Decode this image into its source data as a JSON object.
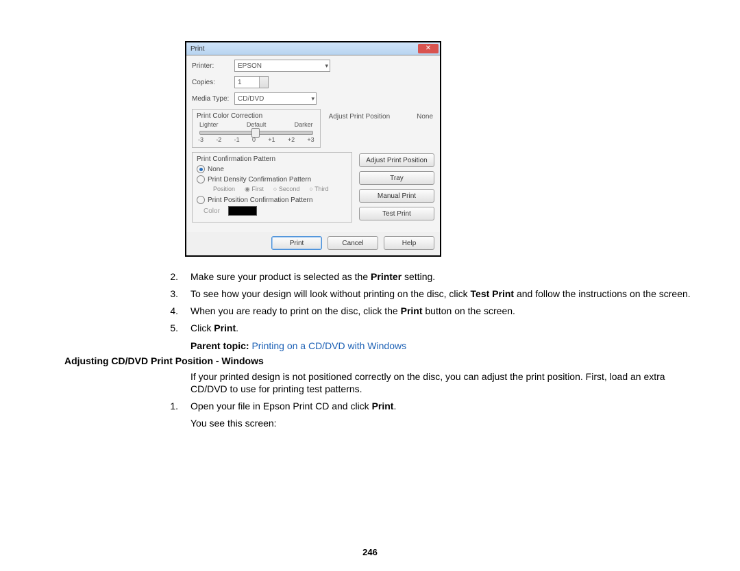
{
  "dialog": {
    "title": "Print",
    "printer_label": "Printer:",
    "printer_value": "EPSON",
    "copies_label": "Copies:",
    "copies_value": "1",
    "media_label": "Media Type:",
    "media_value": "CD/DVD",
    "pcc_title": "Print Color Correction",
    "pcc_lighter": "Lighter",
    "pcc_default": "Default",
    "pcc_darker": "Darker",
    "ticks": [
      "-3",
      "-2",
      "-1",
      "0",
      "+1",
      "+2",
      "+3"
    ],
    "adjust_pos_label": "Adjust Print Position",
    "adjust_pos_value": "None",
    "confirm_title": "Print Confirmation Pattern",
    "opt_none": "None",
    "opt_density": "Print Density Confirmation Pattern",
    "pos_label": "Position",
    "pos_first": "First",
    "pos_second": "Second",
    "pos_third": "Third",
    "opt_position": "Print Position Confirmation Pattern",
    "color_label": "Color",
    "side_btns": {
      "adjust": "Adjust Print Position",
      "tray": "Tray",
      "manual": "Manual Print",
      "test": "Test Print"
    },
    "bottom": {
      "print": "Print",
      "cancel": "Cancel",
      "help": "Help"
    }
  },
  "steps_a": [
    {
      "n": "2.",
      "pre": "Make sure your product is selected as the ",
      "b": "Printer",
      "post": " setting."
    },
    {
      "n": "3.",
      "pre": "To see how your design will look without printing on the disc, click ",
      "b": "Test Print",
      "post": " and follow the instructions on the screen."
    },
    {
      "n": "4.",
      "pre": "When you are ready to print on the disc, click the ",
      "b": "Print",
      "post": " button on the screen."
    },
    {
      "n": "5.",
      "pre": "Click ",
      "b": "Print",
      "post": "."
    }
  ],
  "parent": {
    "label": "Parent topic: ",
    "link": "Printing on a CD/DVD with Windows"
  },
  "section_heading": "Adjusting CD/DVD Print Position - Windows",
  "section_p": "If your printed design is not positioned correctly on the disc, you can adjust the print position. First, load an extra CD/DVD to use for printing test patterns.",
  "steps_b": [
    {
      "n": "1.",
      "pre": "Open your file in Epson Print CD and click ",
      "b": "Print",
      "post": "."
    }
  ],
  "after_step": "You see this screen:",
  "page_number": "246"
}
